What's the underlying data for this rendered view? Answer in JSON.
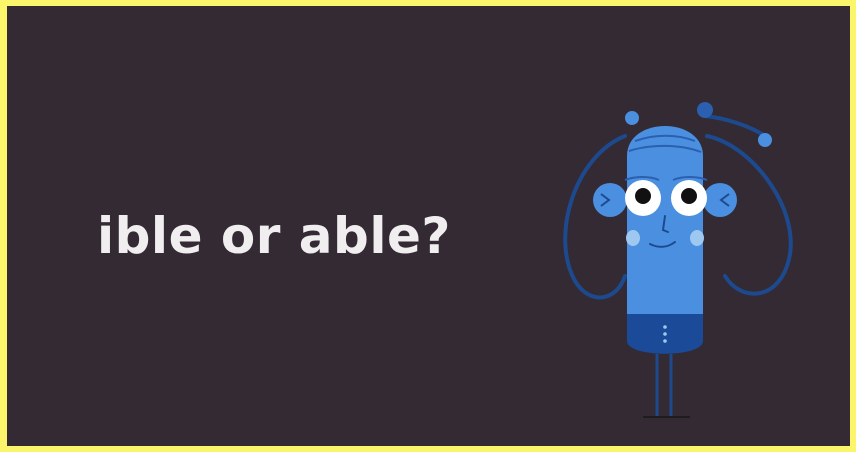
{
  "slide": {
    "headline": "ible or able?"
  },
  "character": {
    "icon": "cartoon-thinking-character-icon",
    "colors": {
      "body": "#4a8fe0",
      "body_dark": "#2b5fb0",
      "outline": "#1d4a8e",
      "shorts": "#1a4a98",
      "cheek": "#9ec8f0",
      "eye_white": "#ffffff",
      "pupil": "#111111"
    }
  },
  "colors": {
    "background": "#332a33",
    "border": "#fbf56c",
    "text": "#f1eef0"
  }
}
